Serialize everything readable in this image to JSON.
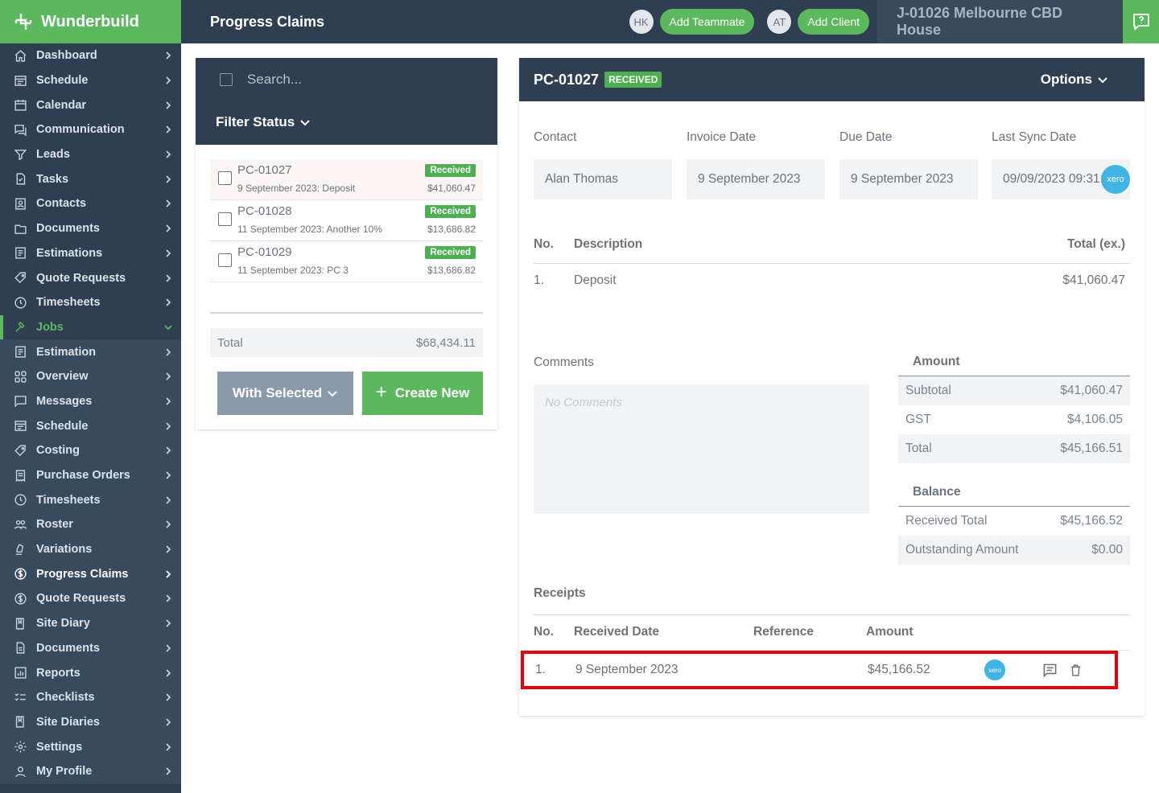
{
  "app": {
    "name": "Wunderbuild"
  },
  "header": {
    "title": "Progress Claims",
    "avatar1": "HK",
    "add_teammate": "Add Teammate",
    "avatar2": "AT",
    "add_client": "Add Client",
    "job": "J-01026 Melbourne CBD House"
  },
  "sidebar": {
    "items": [
      {
        "label": "Dashboard",
        "icon": "home-icon"
      },
      {
        "label": "Schedule",
        "icon": "schedule-icon"
      },
      {
        "label": "Calendar",
        "icon": "calendar-icon"
      },
      {
        "label": "Communication",
        "icon": "chat-icon"
      },
      {
        "label": "Leads",
        "icon": "leads-icon"
      },
      {
        "label": "Tasks",
        "icon": "tasks-icon"
      },
      {
        "label": "Contacts",
        "icon": "contacts-icon"
      },
      {
        "label": "Documents",
        "icon": "folder-icon"
      },
      {
        "label": "Estimations",
        "icon": "estimation-icon"
      },
      {
        "label": "Quote Requests",
        "icon": "tag-icon"
      },
      {
        "label": "Timesheets",
        "icon": "clock-icon"
      },
      {
        "label": "Jobs",
        "icon": "hammer-icon"
      },
      {
        "label": "Estimation",
        "icon": "estimation-icon"
      },
      {
        "label": "Overview",
        "icon": "grid-icon"
      },
      {
        "label": "Messages",
        "icon": "message-icon"
      },
      {
        "label": "Schedule",
        "icon": "schedule-icon"
      },
      {
        "label": "Costing",
        "icon": "tag-icon"
      },
      {
        "label": "Purchase Orders",
        "icon": "receipt-icon"
      },
      {
        "label": "Timesheets",
        "icon": "clock-icon"
      },
      {
        "label": "Roster",
        "icon": "people-icon"
      },
      {
        "label": "Variations",
        "icon": "variations-icon"
      },
      {
        "label": "Progress Claims",
        "icon": "dollar-icon"
      },
      {
        "label": "Quote Requests",
        "icon": "dollar-icon"
      },
      {
        "label": "Site Diary",
        "icon": "book-icon"
      },
      {
        "label": "Documents",
        "icon": "document-icon"
      },
      {
        "label": "Reports",
        "icon": "chart-icon"
      },
      {
        "label": "Checklists",
        "icon": "checklist-icon"
      },
      {
        "label": "Site Diaries",
        "icon": "book-icon"
      },
      {
        "label": "Settings",
        "icon": "gear-icon"
      },
      {
        "label": "My Profile",
        "icon": "user-icon"
      }
    ]
  },
  "list": {
    "search_placeholder": "Search...",
    "filter_label": "Filter Status",
    "claims": [
      {
        "number": "PC-01027",
        "desc": "9 September 2023: Deposit",
        "status": "Received",
        "amount": "$41,060.47"
      },
      {
        "number": "PC-01028",
        "desc": "11 September 2023: Another 10%",
        "status": "Received",
        "amount": "$13,686.82"
      },
      {
        "number": "PC-01029",
        "desc": "11 September 2023: PC 3",
        "status": "Received",
        "amount": "$13,686.82"
      }
    ],
    "total_label": "Total",
    "total_value": "$68,434.11",
    "with_selected": "With Selected",
    "create_new": "Create New"
  },
  "detail": {
    "number": "PC-01027",
    "status": "RECEIVED",
    "options": "Options",
    "fields": {
      "contact_label": "Contact",
      "contact": "Alan Thomas",
      "invoice_label": "Invoice Date",
      "invoice": "9 September 2023",
      "due_label": "Due Date",
      "due": "9 September 2023",
      "sync_label": "Last Sync Date",
      "sync": "09/09/2023 09:31:56"
    },
    "xero_label": "xero",
    "lines_head": {
      "no": "No.",
      "desc": "Description",
      "total": "Total (ex.)"
    },
    "lines": [
      {
        "no": "1.",
        "desc": "Deposit",
        "total": "$41,060.47"
      }
    ],
    "comments_label": "Comments",
    "comments_placeholder": "No Comments",
    "amount": {
      "title": "Amount",
      "subtotal_label": "Subtotal",
      "subtotal": "$41,060.47",
      "gst_label": "GST",
      "gst": "$4,106.05",
      "total_label": "Total",
      "total": "$45,166.51"
    },
    "balance": {
      "title": "Balance",
      "received_label": "Received Total",
      "received": "$45,166.52",
      "outstanding_label": "Outstanding Amount",
      "outstanding": "$0.00"
    },
    "receipts": {
      "title": "Receipts",
      "head": {
        "no": "No.",
        "date": "Received Date",
        "ref": "Reference",
        "amount": "Amount"
      },
      "rows": [
        {
          "no": "1.",
          "date": "9 September 2023",
          "ref": "",
          "amount": "$45,166.52"
        }
      ]
    }
  },
  "colors": {
    "brand": "#5cb85c",
    "navy": "#2f3e50",
    "xero": "#3fb4e5",
    "highlight": "#e8000b"
  }
}
